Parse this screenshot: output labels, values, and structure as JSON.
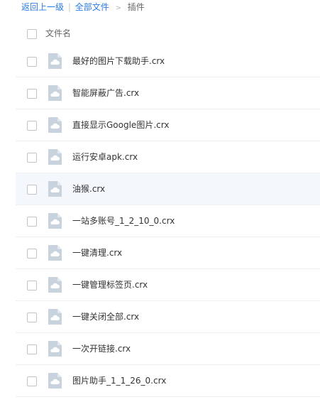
{
  "breadcrumb": {
    "back": "返回上一级",
    "separator": "|",
    "all_files": "全部文件",
    "arrow": ">",
    "current": "插件"
  },
  "list": {
    "header_label": "文件名",
    "files": [
      {
        "name": "最好的图片下载助手.crx"
      },
      {
        "name": "智能屏蔽广告.crx"
      },
      {
        "name": "直接显示Google图片.crx"
      },
      {
        "name": "运行安卓apk.crx"
      },
      {
        "name": "油猴.crx"
      },
      {
        "name": "一站多账号_1_2_10_0.crx"
      },
      {
        "name": "一键清理.crx"
      },
      {
        "name": "一键管理标签页.crx"
      },
      {
        "name": "一键关闭全部.crx"
      },
      {
        "name": "一次开链接.crx"
      },
      {
        "name": "图片助手_1_1_26_0.crx"
      }
    ]
  },
  "colors": {
    "link": "#2c7be5",
    "icon_fill": "#c8d3de",
    "highlight_row": "#f4f7fb"
  },
  "icons": {
    "file_icon": "cloud-file-icon"
  }
}
